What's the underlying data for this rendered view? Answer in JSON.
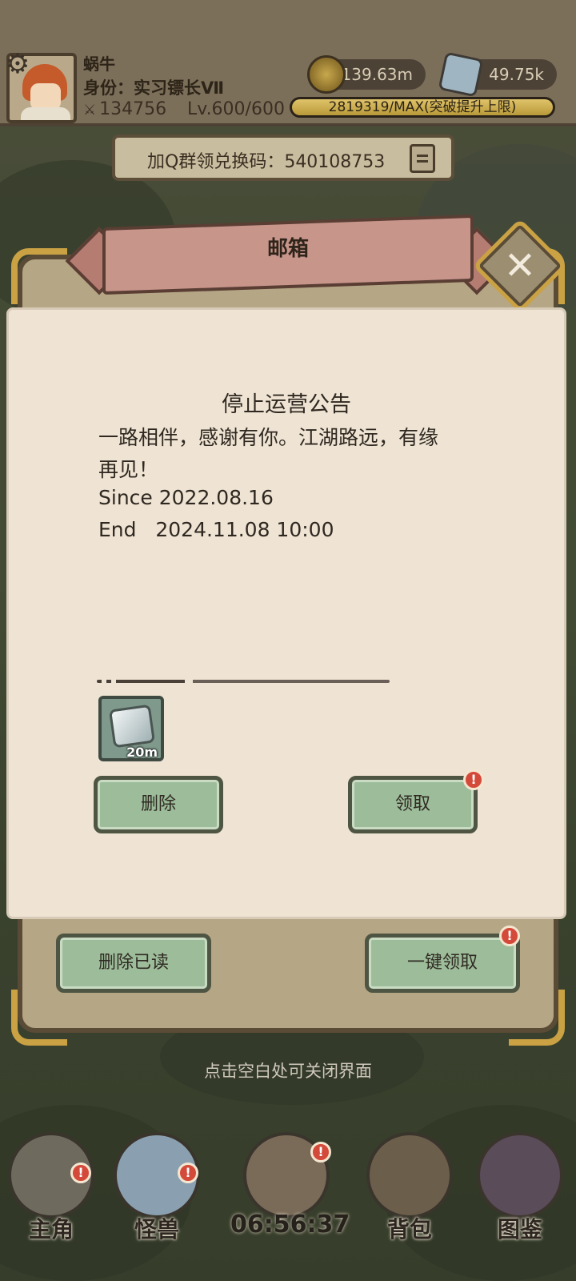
{
  "player": {
    "name": "蜗牛",
    "title": "身份：实习镖长Ⅶ",
    "power": "134756",
    "level": "Lv.600/600"
  },
  "resources": {
    "coin": "139.63m",
    "gem": "49.75k",
    "xp_text": "2819319/MAX(突破提升上限)",
    "xp_progress": 1.0
  },
  "qq_banner": {
    "text": "加Q群领兑换码：540108753"
  },
  "mailbox": {
    "title": "邮箱",
    "notice_title": "停止运营公告",
    "lines": [
      "一路相伴，感谢有你。江湖路远，有缘",
      "再见！",
      "Since 2022.08.16",
      "End   2024.11.08 10:00"
    ],
    "attachment_qty": "20m",
    "delete_label": "删除",
    "claim_label": "领取",
    "delete_read_label": "删除已读",
    "claim_all_label": "一键领取",
    "badge": "!"
  },
  "hint": "点击空白处可关闭界面",
  "nav": {
    "hero": "主角",
    "monster": "怪兽",
    "bag": "背包",
    "codex": "图鉴",
    "timer": "06:56:37"
  }
}
